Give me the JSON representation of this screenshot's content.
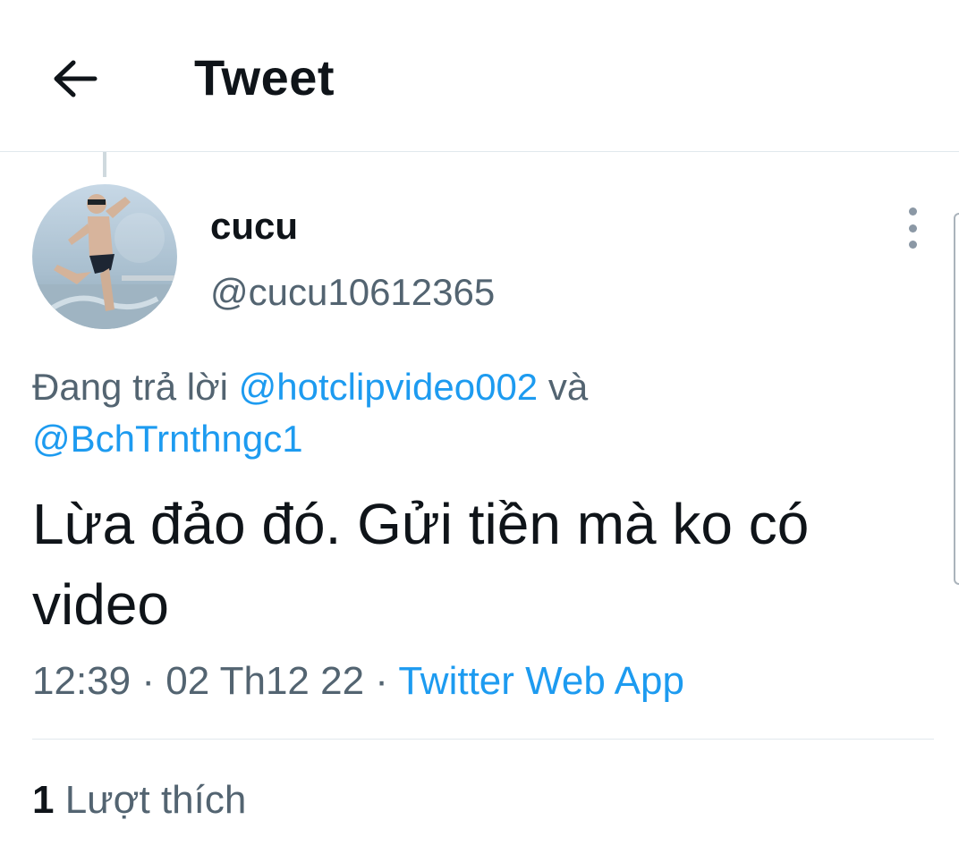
{
  "header": {
    "title": "Tweet",
    "back_icon": "arrow-left-icon"
  },
  "author": {
    "display_name": "cucu",
    "handle": "@cucu10612365",
    "avatar_icon": "user-avatar-photo"
  },
  "reply": {
    "prefix": "Đang trả lời ",
    "mention_1": "@hotclipvideo002",
    "joiner": " và",
    "mention_2": "@BchTrnthngc1"
  },
  "tweet": {
    "text": "Lừa đảo đó. Gửi tiền mà ko có video"
  },
  "meta": {
    "time": "12:39",
    "separator_1": " · ",
    "date": "02 Th12 22",
    "separator_2": " · ",
    "source": "Twitter Web App"
  },
  "stats": {
    "likes_count": "1",
    "likes_label": " Lượt thích"
  },
  "colors": {
    "link": "#1d9bf0",
    "secondary_text": "#536471",
    "primary_text": "#0f1419",
    "divider": "#e1e8ed"
  }
}
